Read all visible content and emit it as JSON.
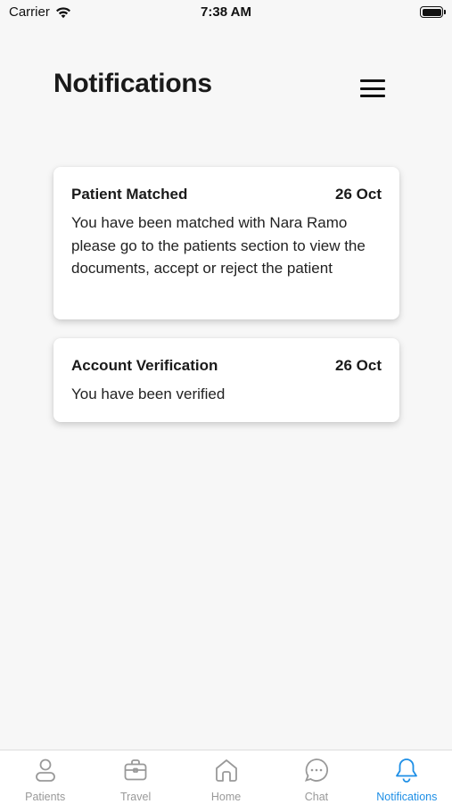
{
  "status_bar": {
    "carrier": "Carrier",
    "time": "7:38 AM",
    "icons": [
      "wifi-icon",
      "battery-icon"
    ]
  },
  "header": {
    "title": "Notifications",
    "menu_icon": "hamburger-menu-icon"
  },
  "notifications": [
    {
      "title": "Patient Matched",
      "date": "26 Oct",
      "body": "You have been matched with Nara Ramo please go to the patients section to view the documents, accept or reject the patient"
    },
    {
      "title": "Account Verification",
      "date": "26 Oct",
      "body": "You have been verified"
    }
  ],
  "tab_bar": {
    "tabs": [
      {
        "label": "Patients",
        "icon": "person-icon"
      },
      {
        "label": "Travel",
        "icon": "suitcase-icon"
      },
      {
        "label": "Home",
        "icon": "home-icon"
      },
      {
        "label": "Chat",
        "icon": "chat-bubble-icon"
      },
      {
        "label": "Notifications",
        "icon": "bell-icon"
      }
    ],
    "active_index": 4,
    "active_color": "#1e8fe6",
    "inactive_color": "#999999"
  }
}
